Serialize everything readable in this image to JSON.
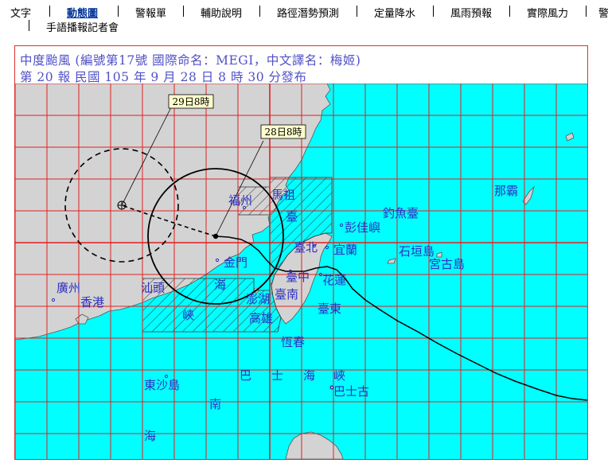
{
  "nav": {
    "row1": [
      {
        "label": "文字",
        "active": false
      },
      {
        "label": "動態圖",
        "active": true
      },
      {
        "label": "警報單",
        "active": false
      },
      {
        "label": "輔助說明",
        "active": false
      },
      {
        "label": "路徑潛勢預測",
        "active": false
      },
      {
        "label": "定量降水",
        "active": false
      },
      {
        "label": "風雨預報",
        "active": false
      },
      {
        "label": "實際風力",
        "active": false
      },
      {
        "label": "警",
        "active": false
      }
    ],
    "row2": [
      {
        "label": "手語播報記者會",
        "active": false
      }
    ]
  },
  "panel": {
    "title_line1": "中度颱風 (編號第17號 國際命名：MEGI，中文譯名：梅姬)",
    "title_line2": "第 20 報 民國 105 年 9 月 28 日 8 時 30 分發布"
  },
  "map": {
    "forecast_label": "29日8時",
    "current_label": "28日8時",
    "place_labels": {
      "fuzhou": "福州",
      "mazu": "馬祖",
      "taiwan": "臺",
      "diaoyutai": "釣魚臺",
      "pengjiayu": "彭佳嶼",
      "taipei": "臺北",
      "yilan": "宜蘭",
      "shigaki": "石垣島",
      "miyako": "宮古島",
      "naha": "那霸",
      "kinmen": "金門",
      "taichung": "臺中",
      "hualien": "花蓮",
      "guangzhou": "廣州",
      "hongkong": "香港",
      "shantou": "汕頭",
      "strait_hai": "海",
      "strait_xia": "峽",
      "penghu": "澎湖",
      "tainan": "臺南",
      "taitung": "臺東",
      "kaohsiung": "高雄",
      "hengchun": "恆春",
      "dongsha": "東沙島",
      "bashi_ba": "巴",
      "bashi_shi": "士",
      "bashi_hai": "海",
      "bashi_xia": "峽",
      "basco": "巴士古",
      "south_nan": "南",
      "south_hai": "海"
    },
    "colors": {
      "sea": "#00ffff",
      "land": "#d3d3d3",
      "grid": "#e02020",
      "text": "#3030c0",
      "label_box": "#ffffcc"
    }
  }
}
